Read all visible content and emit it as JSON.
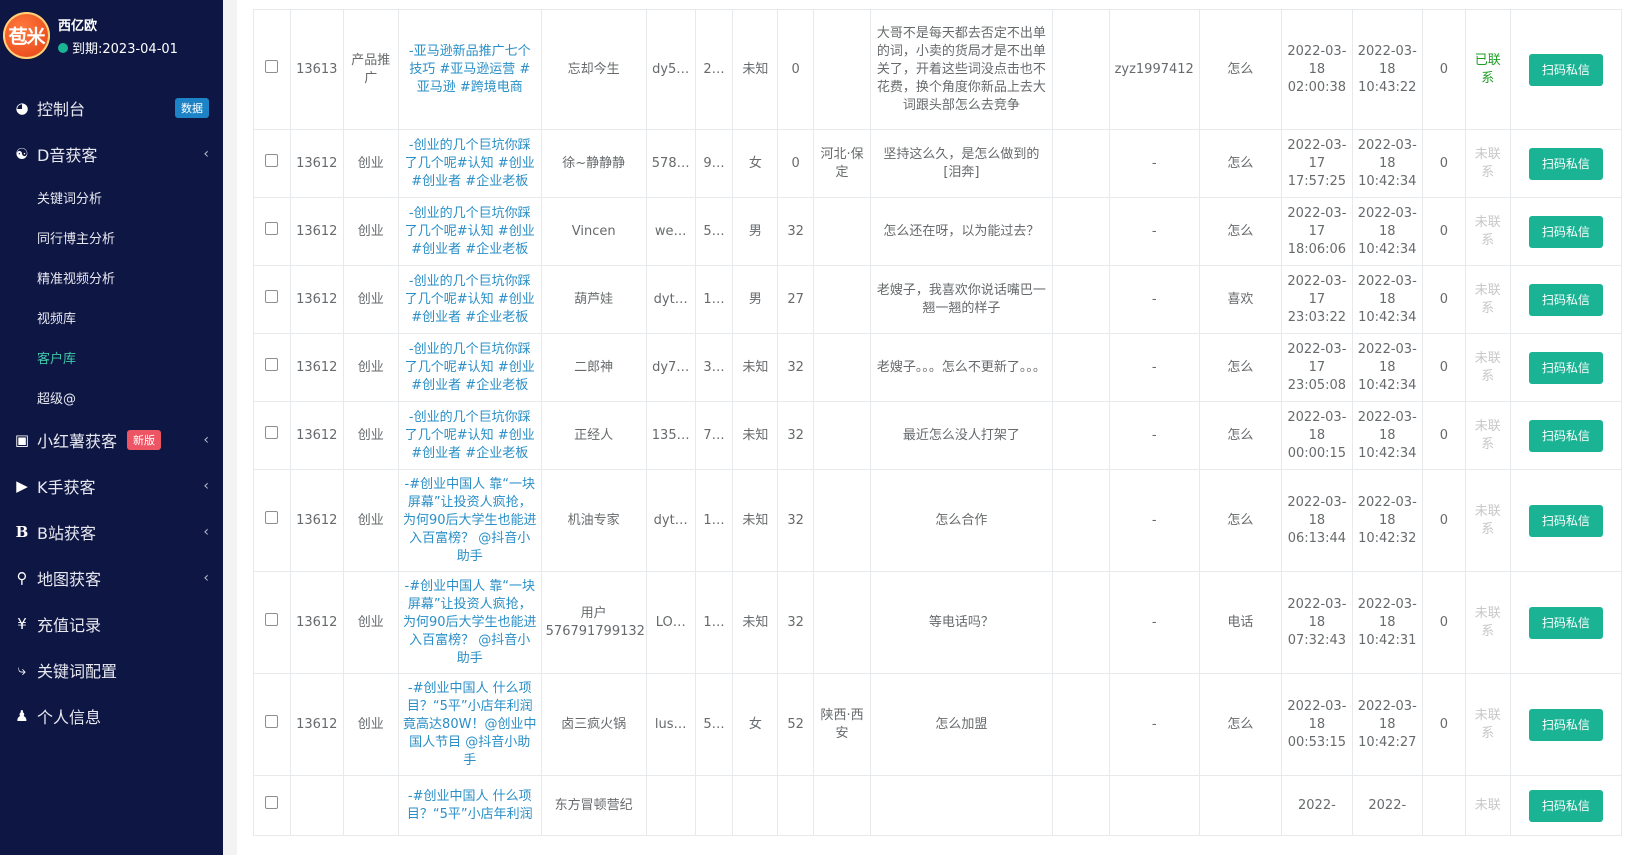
{
  "brand": {
    "logo_text": "苞米",
    "username": "西亿欧",
    "expire_text": "到期:2023-04-01"
  },
  "nav": {
    "dashboard": {
      "label": "控制台",
      "badge": "数据"
    },
    "douyin": {
      "label": "D音获客"
    },
    "douyin_sub": [
      "关键词分析",
      "同行博主分析",
      "精准视频分析",
      "视频库",
      "客户库",
      "超级@"
    ],
    "xhs": {
      "label": "小红薯获客",
      "badge": "新版"
    },
    "kuaishou": {
      "label": "K手获客"
    },
    "bili": {
      "label": "B站获客"
    },
    "map": {
      "label": "地图获客"
    },
    "recharge": {
      "label": "充值记录"
    },
    "keywords": {
      "label": "关键词配置"
    },
    "profile": {
      "label": "个人信息"
    }
  },
  "table": {
    "button_label": "扫码私信",
    "rows": [
      {
        "id": "13613",
        "cat": "产品推广",
        "video": "-亚马逊新品推广七个技巧 #亚马逊运营 #亚马逊 #跨境电商",
        "nick": "忘却今生",
        "acct": "dy5…",
        "fans": "2…",
        "gender": "未知",
        "age": "0",
        "region": "",
        "comment": "大哥不是每天都去否定不出单的词，小卖的货局才是不出单关了，开着这些词没点击也不花费，换个角度你新品上去大词跟头部怎么去竞争",
        "wechat": "zyz1997412",
        "kw": "怎么",
        "t1": "2022-03-18 02:00:38",
        "t2": "2022-03-18 10:43:22",
        "n": "0",
        "status": "已联系",
        "contacted": true
      },
      {
        "id": "13612",
        "cat": "创业",
        "video": "-创业的几个巨坑你踩了几个呢#认知 #创业 #创业者 #企业老板",
        "nick": "徐~静静静",
        "acct": "578…",
        "fans": "9…",
        "gender": "女",
        "age": "0",
        "region": "河北·保定",
        "comment": "坚持这么久，是怎么做到的[泪奔]",
        "wechat": "-",
        "kw": "怎么",
        "t1": "2022-03-17 17:57:25",
        "t2": "2022-03-18 10:42:34",
        "n": "0",
        "status": "未联系",
        "contacted": false
      },
      {
        "id": "13612",
        "cat": "创业",
        "video": "-创业的几个巨坑你踩了几个呢#认知 #创业 #创业者 #企业老板",
        "nick": "Vincen",
        "acct": "we…",
        "fans": "5…",
        "gender": "男",
        "age": "32",
        "region": "",
        "comment": "怎么还在呀，以为能过去？",
        "wechat": "-",
        "kw": "怎么",
        "t1": "2022-03-17 18:06:06",
        "t2": "2022-03-18 10:42:34",
        "n": "0",
        "status": "未联系",
        "contacted": false
      },
      {
        "id": "13612",
        "cat": "创业",
        "video": "-创业的几个巨坑你踩了几个呢#认知 #创业 #创业者 #企业老板",
        "nick": "葫芦娃",
        "acct": "dyt…",
        "fans": "1…",
        "gender": "男",
        "age": "27",
        "region": "",
        "comment": "老嫂子，我喜欢你说话嘴巴一翘一翘的样子",
        "wechat": "-",
        "kw": "喜欢",
        "t1": "2022-03-17 23:03:22",
        "t2": "2022-03-18 10:42:34",
        "n": "0",
        "status": "未联系",
        "contacted": false
      },
      {
        "id": "13612",
        "cat": "创业",
        "video": "-创业的几个巨坑你踩了几个呢#认知 #创业 #创业者 #企业老板",
        "nick": "二郎神",
        "acct": "dy7…",
        "fans": "3…",
        "gender": "未知",
        "age": "32",
        "region": "",
        "comment": "老嫂子。。。怎么不更新了。。。",
        "wechat": "-",
        "kw": "怎么",
        "t1": "2022-03-17 23:05:08",
        "t2": "2022-03-18 10:42:34",
        "n": "0",
        "status": "未联系",
        "contacted": false
      },
      {
        "id": "13612",
        "cat": "创业",
        "video": "-创业的几个巨坑你踩了几个呢#认知 #创业 #创业者 #企业老板",
        "nick": "正经人",
        "acct": "135…",
        "fans": "7…",
        "gender": "未知",
        "age": "32",
        "region": "",
        "comment": "最近怎么没人打架了",
        "wechat": "-",
        "kw": "怎么",
        "t1": "2022-03-18 00:00:15",
        "t2": "2022-03-18 10:42:34",
        "n": "0",
        "status": "未联系",
        "contacted": false
      },
      {
        "id": "13612",
        "cat": "创业",
        "video": "-#创业中国人 靠“一块屏幕”让投资人疯抢，为何90后大学生也能进入百富榜？ @抖音小助手",
        "nick": "机油专家",
        "acct": "dyt…",
        "fans": "1…",
        "gender": "未知",
        "age": "32",
        "region": "",
        "comment": "怎么合作",
        "wechat": "-",
        "kw": "怎么",
        "t1": "2022-03-18 06:13:44",
        "t2": "2022-03-18 10:42:32",
        "n": "0",
        "status": "未联系",
        "contacted": false
      },
      {
        "id": "13612",
        "cat": "创业",
        "video": "-#创业中国人 靠“一块屏幕”让投资人疯抢，为何90后大学生也能进入百富榜？ @抖音小助手",
        "nick": "用户576791799132",
        "acct": "LO…",
        "fans": "1…",
        "gender": "未知",
        "age": "32",
        "region": "",
        "comment": "等电话吗？",
        "wechat": "-",
        "kw": "电话",
        "t1": "2022-03-18 07:32:43",
        "t2": "2022-03-18 10:42:31",
        "n": "0",
        "status": "未联系",
        "contacted": false
      },
      {
        "id": "13612",
        "cat": "创业",
        "video": "-#创业中国人 什么项目？“5平”小店年利润竟高达80W！@创业中国人节目 @抖音小助手",
        "nick": "卤三疯火锅",
        "acct": "lus…",
        "fans": "5…",
        "gender": "女",
        "age": "52",
        "region": "陕西·西安",
        "comment": "怎么加盟",
        "wechat": "-",
        "kw": "怎么",
        "t1": "2022-03-18 00:53:15",
        "t2": "2022-03-18 10:42:27",
        "n": "0",
        "status": "未联系",
        "contacted": false
      },
      {
        "id": "",
        "cat": "",
        "video": "-#创业中国人 什么项目？“5平”小店年利润",
        "nick": "东方冒顿营纪",
        "acct": "",
        "fans": "",
        "gender": "",
        "age": "",
        "region": "",
        "comment": "",
        "wechat": "",
        "kw": "",
        "t1": "2022-",
        "t2": "2022-",
        "n": "",
        "status": "未联",
        "contacted": false
      }
    ]
  }
}
